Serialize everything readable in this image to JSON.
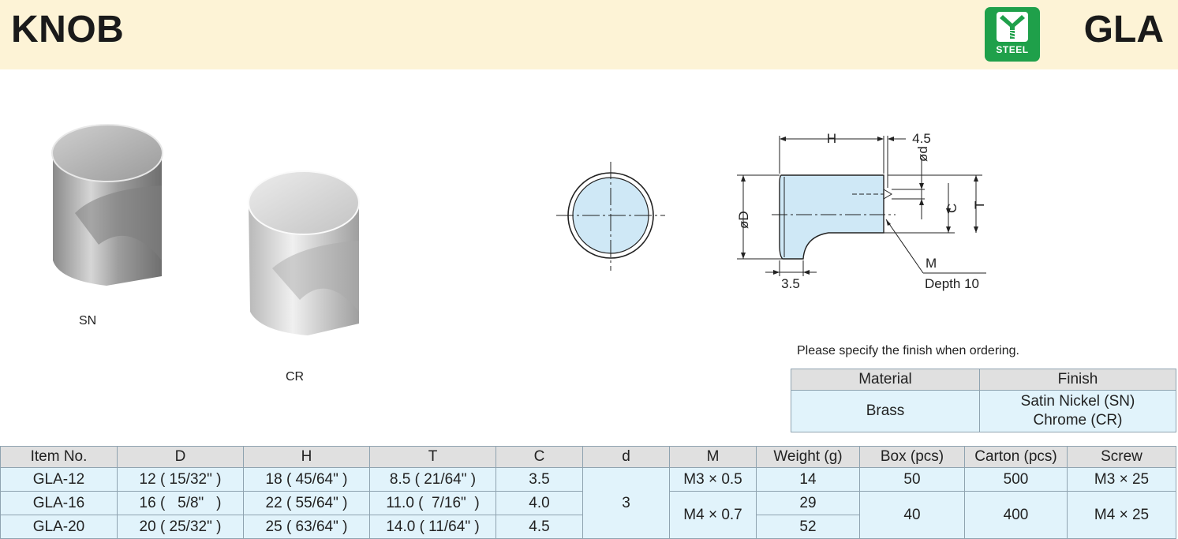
{
  "header": {
    "title": "KNOB",
    "code": "GLA",
    "badge_label": "STEEL",
    "badge_color": "#1fa04a"
  },
  "photos": [
    {
      "label": "SN",
      "finish_color": "#b5b5b5"
    },
    {
      "label": "CR",
      "finish_color": "#d8d8d8"
    }
  ],
  "drawing": {
    "dims": {
      "H": "H",
      "offset": "4.5",
      "d": "ød",
      "D": "øD",
      "C": "C",
      "T": "T",
      "base": "3.5",
      "M": "M",
      "depth": "Depth 10"
    }
  },
  "order_note": "Please specify the finish when ordering.",
  "material_table": {
    "headers": [
      "Material",
      "Finish"
    ],
    "material": "Brass",
    "finishes": [
      "Satin Nickel (SN)",
      "Chrome (CR)"
    ]
  },
  "spec_table": {
    "headers": [
      "Item No.",
      "D",
      "H",
      "T",
      "C",
      "d",
      "M",
      "Weight (g)",
      "Box (pcs)",
      "Carton (pcs)",
      "Screw"
    ],
    "rows": [
      {
        "item": "GLA-12",
        "D": "12 ( 15/32\" )",
        "H": "18 ( 45/64\" )",
        "T": "8.5 ( 21/64\" )",
        "C": "3.5",
        "weight": "14"
      },
      {
        "item": "GLA-16",
        "D": "16 (   5/8\"   )",
        "H": "22 ( 55/64\" )",
        "T": "11.0 (  7/16\"  )",
        "C": "4.0",
        "weight": "29"
      },
      {
        "item": "GLA-20",
        "D": "20 ( 25/32\" )",
        "H": "25 ( 63/64\" )",
        "T": "14.0 ( 11/64\" )",
        "C": "4.5",
        "weight": "52"
      }
    ],
    "d_value": "3",
    "M_small": "M3 × 0.5",
    "M_large": "M4 × 0.7",
    "box_small": "50",
    "box_large": "40",
    "carton_small": "500",
    "carton_large": "400",
    "screw_small": "M3 × 25",
    "screw_large": "M4 × 25"
  }
}
